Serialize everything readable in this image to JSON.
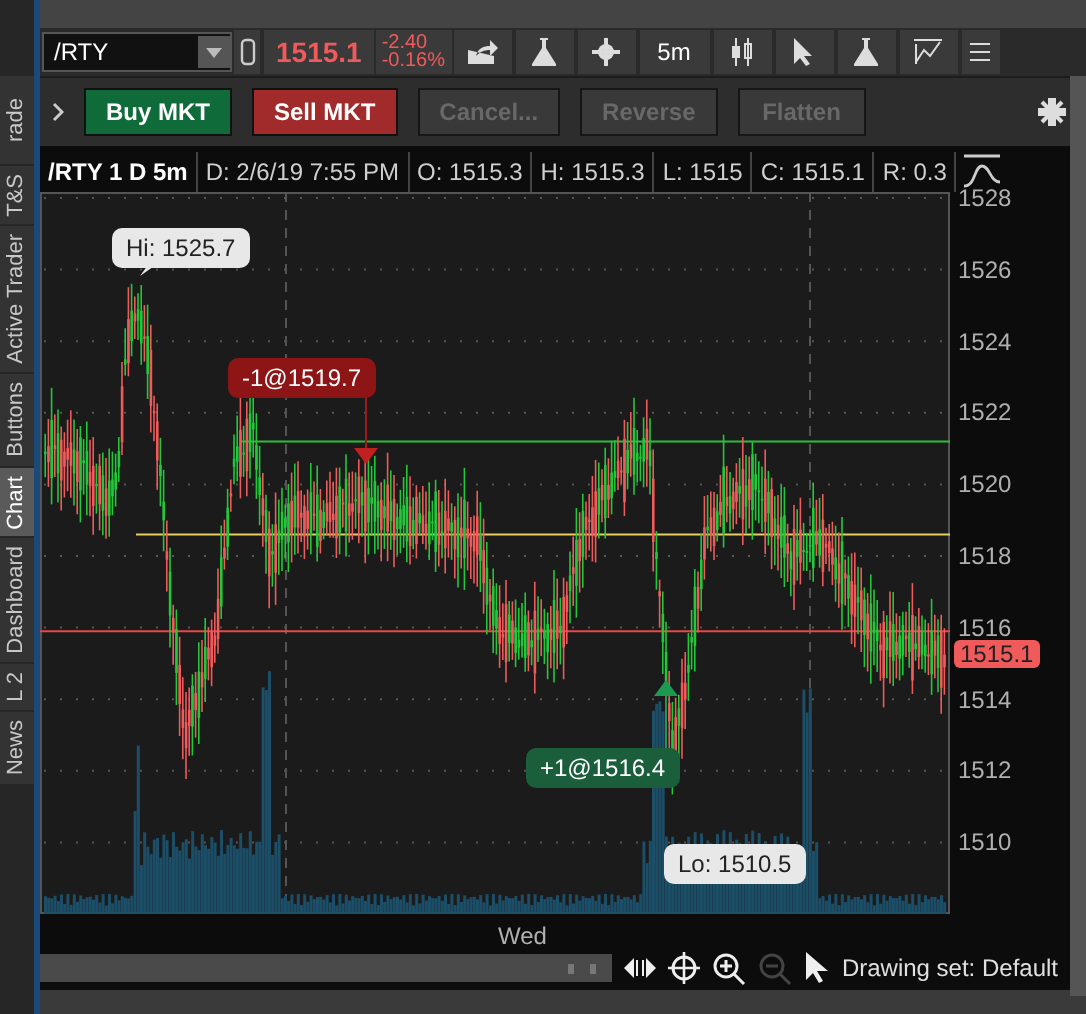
{
  "side_tabs": [
    {
      "label": "rade",
      "selected": false
    },
    {
      "label": "T&S",
      "selected": false
    },
    {
      "label": "Active Trader",
      "selected": false
    },
    {
      "label": "Buttons",
      "selected": false
    },
    {
      "label": "Chart",
      "selected": true
    },
    {
      "label": "Dashboard",
      "selected": false
    },
    {
      "label": "L 2",
      "selected": false
    },
    {
      "label": "News",
      "selected": false
    }
  ],
  "toolbar": {
    "symbol": "/RTY",
    "last": "1515.1",
    "change": "-2.40",
    "change_pct": "-0.16%",
    "interval": "5m"
  },
  "order_bar": [
    {
      "label": "Buy MKT",
      "kind": "buy",
      "disabled": false
    },
    {
      "label": "Sell MKT",
      "kind": "sell",
      "disabled": false
    },
    {
      "label": "Cancel...",
      "kind": "plain",
      "disabled": true
    },
    {
      "label": "Reverse",
      "kind": "plain",
      "disabled": true
    },
    {
      "label": "Flatten",
      "kind": "plain",
      "disabled": true
    }
  ],
  "chart_header": [
    "/RTY 1 D 5m",
    "D: 2/6/19 7:55 PM",
    "O: 1515.3",
    "H: 1515.3",
    "L: 1515",
    "C: 1515.1",
    "R: 0.3"
  ],
  "price_axis": [
    "1528",
    "1526",
    "1524",
    "1522",
    "1520",
    "1518",
    "1516",
    "1514",
    "1512",
    "1510"
  ],
  "current_price": "1515.1",
  "bubbles": [
    {
      "kind": "high",
      "text": "Hi: 1525.7"
    },
    {
      "kind": "sell",
      "text": "-1@1519.7"
    },
    {
      "kind": "buy",
      "text": "+1@1516.4"
    },
    {
      "kind": "low",
      "text": "Lo: 1510.5"
    }
  ],
  "time_axis": [
    "Wed"
  ],
  "drawing_set": "Drawing set: Default"
}
